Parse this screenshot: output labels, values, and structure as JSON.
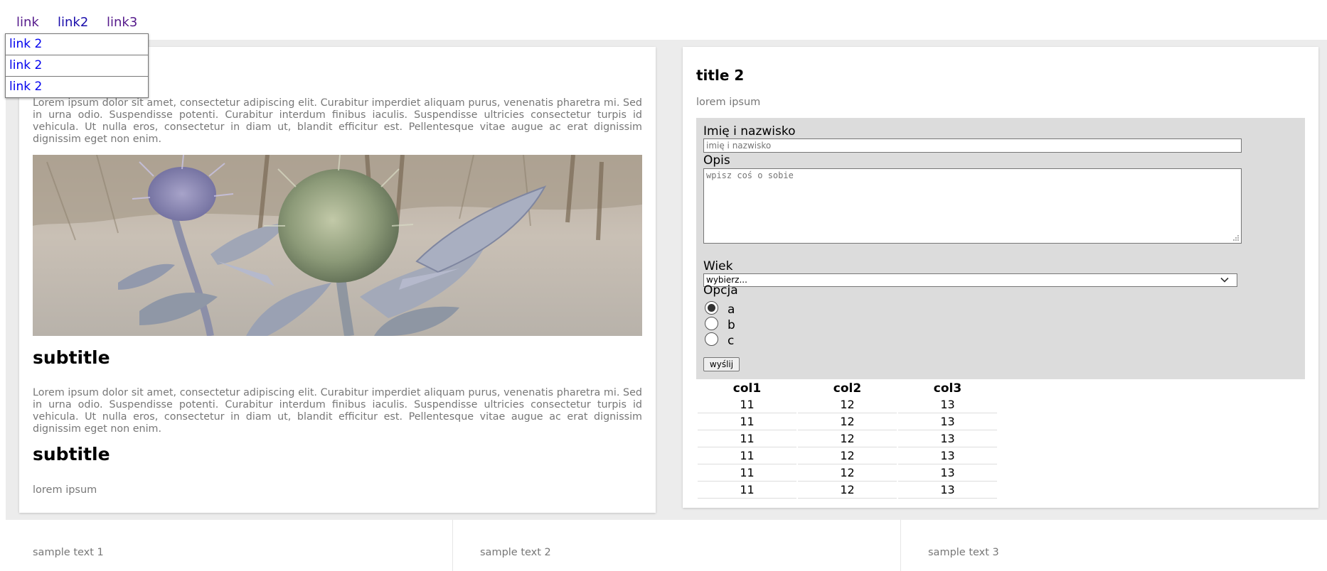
{
  "nav": {
    "links": [
      "link",
      "link2",
      "link3"
    ],
    "dropdown": [
      "link 2",
      "link 2",
      "link 2"
    ]
  },
  "left_card": {
    "paragraph1": "Lorem ipsum dolor sit amet, consectetur adipiscing elit. Curabitur imperdiet aliquam purus, venenatis pharetra mi. Sed in urna odio. Suspendisse potenti. Curabitur interdum finibus iaculis. Suspendisse ultricies consectetur turpis id vehicula. Ut nulla eros, consectetur in diam ut, blandit efficitur est. Pellentesque vitae augue ac erat dignissim dignissim eget non enim.",
    "subtitle1": "subtitle",
    "paragraph2": "Lorem ipsum dolor sit amet, consectetur adipiscing elit. Curabitur imperdiet aliquam purus, venenatis pharetra mi. Sed in urna odio. Suspendisse potenti. Curabitur interdum finibus iaculis. Suspendisse ultricies consectetur turpis id vehicula. Ut nulla eros, consectetur in diam ut, blandit efficitur est. Pellentesque vitae augue ac erat dignissim dignissim eget non enim.",
    "subtitle2": "subtitle",
    "lorem": "lorem ipsum"
  },
  "right_card": {
    "title": "title 2",
    "lorem": "lorem ipsum",
    "form": {
      "name_label": "Imię i nazwisko",
      "name_placeholder": "imię i nazwisko",
      "desc_label": "Opis",
      "desc_placeholder": "wpisz coś o sobie",
      "age_label": "Wiek",
      "age_selected": "wybierz...",
      "option_label": "Opcja",
      "options": [
        "a",
        "b",
        "c"
      ],
      "option_selected": "a",
      "submit_label": "wyślij"
    },
    "table": {
      "headers": [
        "col1",
        "col2",
        "col3"
      ],
      "rows": [
        [
          "11",
          "12",
          "13"
        ],
        [
          "11",
          "12",
          "13"
        ],
        [
          "11",
          "12",
          "13"
        ],
        [
          "11",
          "12",
          "13"
        ],
        [
          "11",
          "12",
          "13"
        ],
        [
          "11",
          "12",
          "13"
        ]
      ]
    }
  },
  "footer": {
    "texts": [
      "sample text 1",
      "sample text 2",
      "sample text 3"
    ]
  }
}
